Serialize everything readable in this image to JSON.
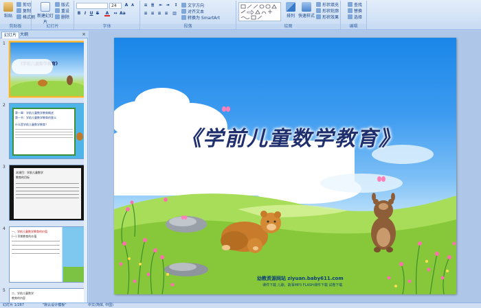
{
  "ribbon": {
    "clipboard": {
      "paste": "粘贴",
      "cut": "剪切",
      "copy": "复制",
      "format_painter": "格式刷",
      "label": "剪贴板"
    },
    "slides": {
      "new_slide": "新建幻灯片",
      "layout": "版式",
      "reset": "重设",
      "delete": "删除",
      "label": "幻灯片"
    },
    "font": {
      "font_name": "",
      "font_size": "24",
      "label": "字体"
    },
    "paragraph": {
      "text_direction": "文字方向",
      "align_text": "对齐文本",
      "smartart": "转换为 SmartArt",
      "label": "段落"
    },
    "drawing": {
      "arrange": "排列",
      "quick_styles": "快速样式",
      "shape_fill": "形状填充",
      "shape_outline": "形状轮廓",
      "shape_effects": "形状效果",
      "label": "绘图"
    },
    "editing": {
      "find": "查找",
      "replace": "替换",
      "select": "选择",
      "label": "编辑"
    }
  },
  "pane": {
    "tab_slides": "幻灯片",
    "tab_outline": "大纲",
    "close": "×",
    "thumbs": [
      {
        "num": "1",
        "title": "《学前儿童数学教育》"
      },
      {
        "num": "2",
        "lines": [
          "第一章：学前儿童数学教育概述",
          "第一节：学前儿童数学教育的意义",
          "什么是学前儿童数学教育？"
        ]
      },
      {
        "num": "3",
        "lines": [
          "本课目：学前儿童数学",
          "教育的目标"
        ]
      },
      {
        "num": "4",
        "lines": [
          "一、学前儿童数学教育的价值",
          "(一) 早期教育的价值"
        ]
      },
      {
        "num": "5",
        "lines": [
          "二、学前儿童数学",
          "教育的内容"
        ]
      }
    ]
  },
  "slide": {
    "title": "《学前儿童数学教育》",
    "credit": "幼教资源网站  ziyuan.baby611.com",
    "credit_sub": "课件下载  儿歌、故事MP3  FLASH课件下载  试卷下载"
  },
  "status": {
    "slide_info": "幻灯片 1/287",
    "theme": "\"默认设计模板\"",
    "language": "中文(简体, 中国)"
  }
}
